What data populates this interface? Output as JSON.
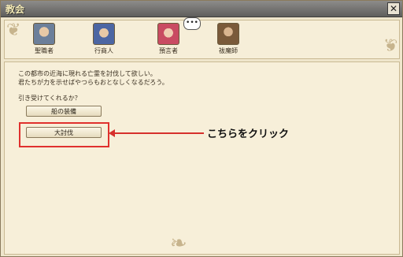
{
  "window": {
    "title": "教会",
    "close_symbol": "✕"
  },
  "npcs": [
    {
      "label": "聖職者",
      "icon": "priest-portrait",
      "color": "#6c7f9a"
    },
    {
      "label": "行商人",
      "icon": "merchant-portrait",
      "color": "#4c66a3"
    },
    {
      "label": "預言者",
      "icon": "prophet-portrait",
      "color": "#c94b62"
    },
    {
      "label": "祓魔師",
      "icon": "exorcist-portrait",
      "color": "#7a5a3a"
    }
  ],
  "more_button": "•••",
  "dialog": {
    "line1": "この都市の近海に現れる亡霊を討伐して欲しい。",
    "line2": "君たちが力を示せばやつらもおとなしくなるだろう。",
    "prompt": "引き受けてくれるか？"
  },
  "options": [
    {
      "label": "船の装備"
    },
    {
      "label": "大討伐"
    }
  ],
  "annotation": {
    "callout_text": "こちらをクリック",
    "color": "#d6302c"
  }
}
